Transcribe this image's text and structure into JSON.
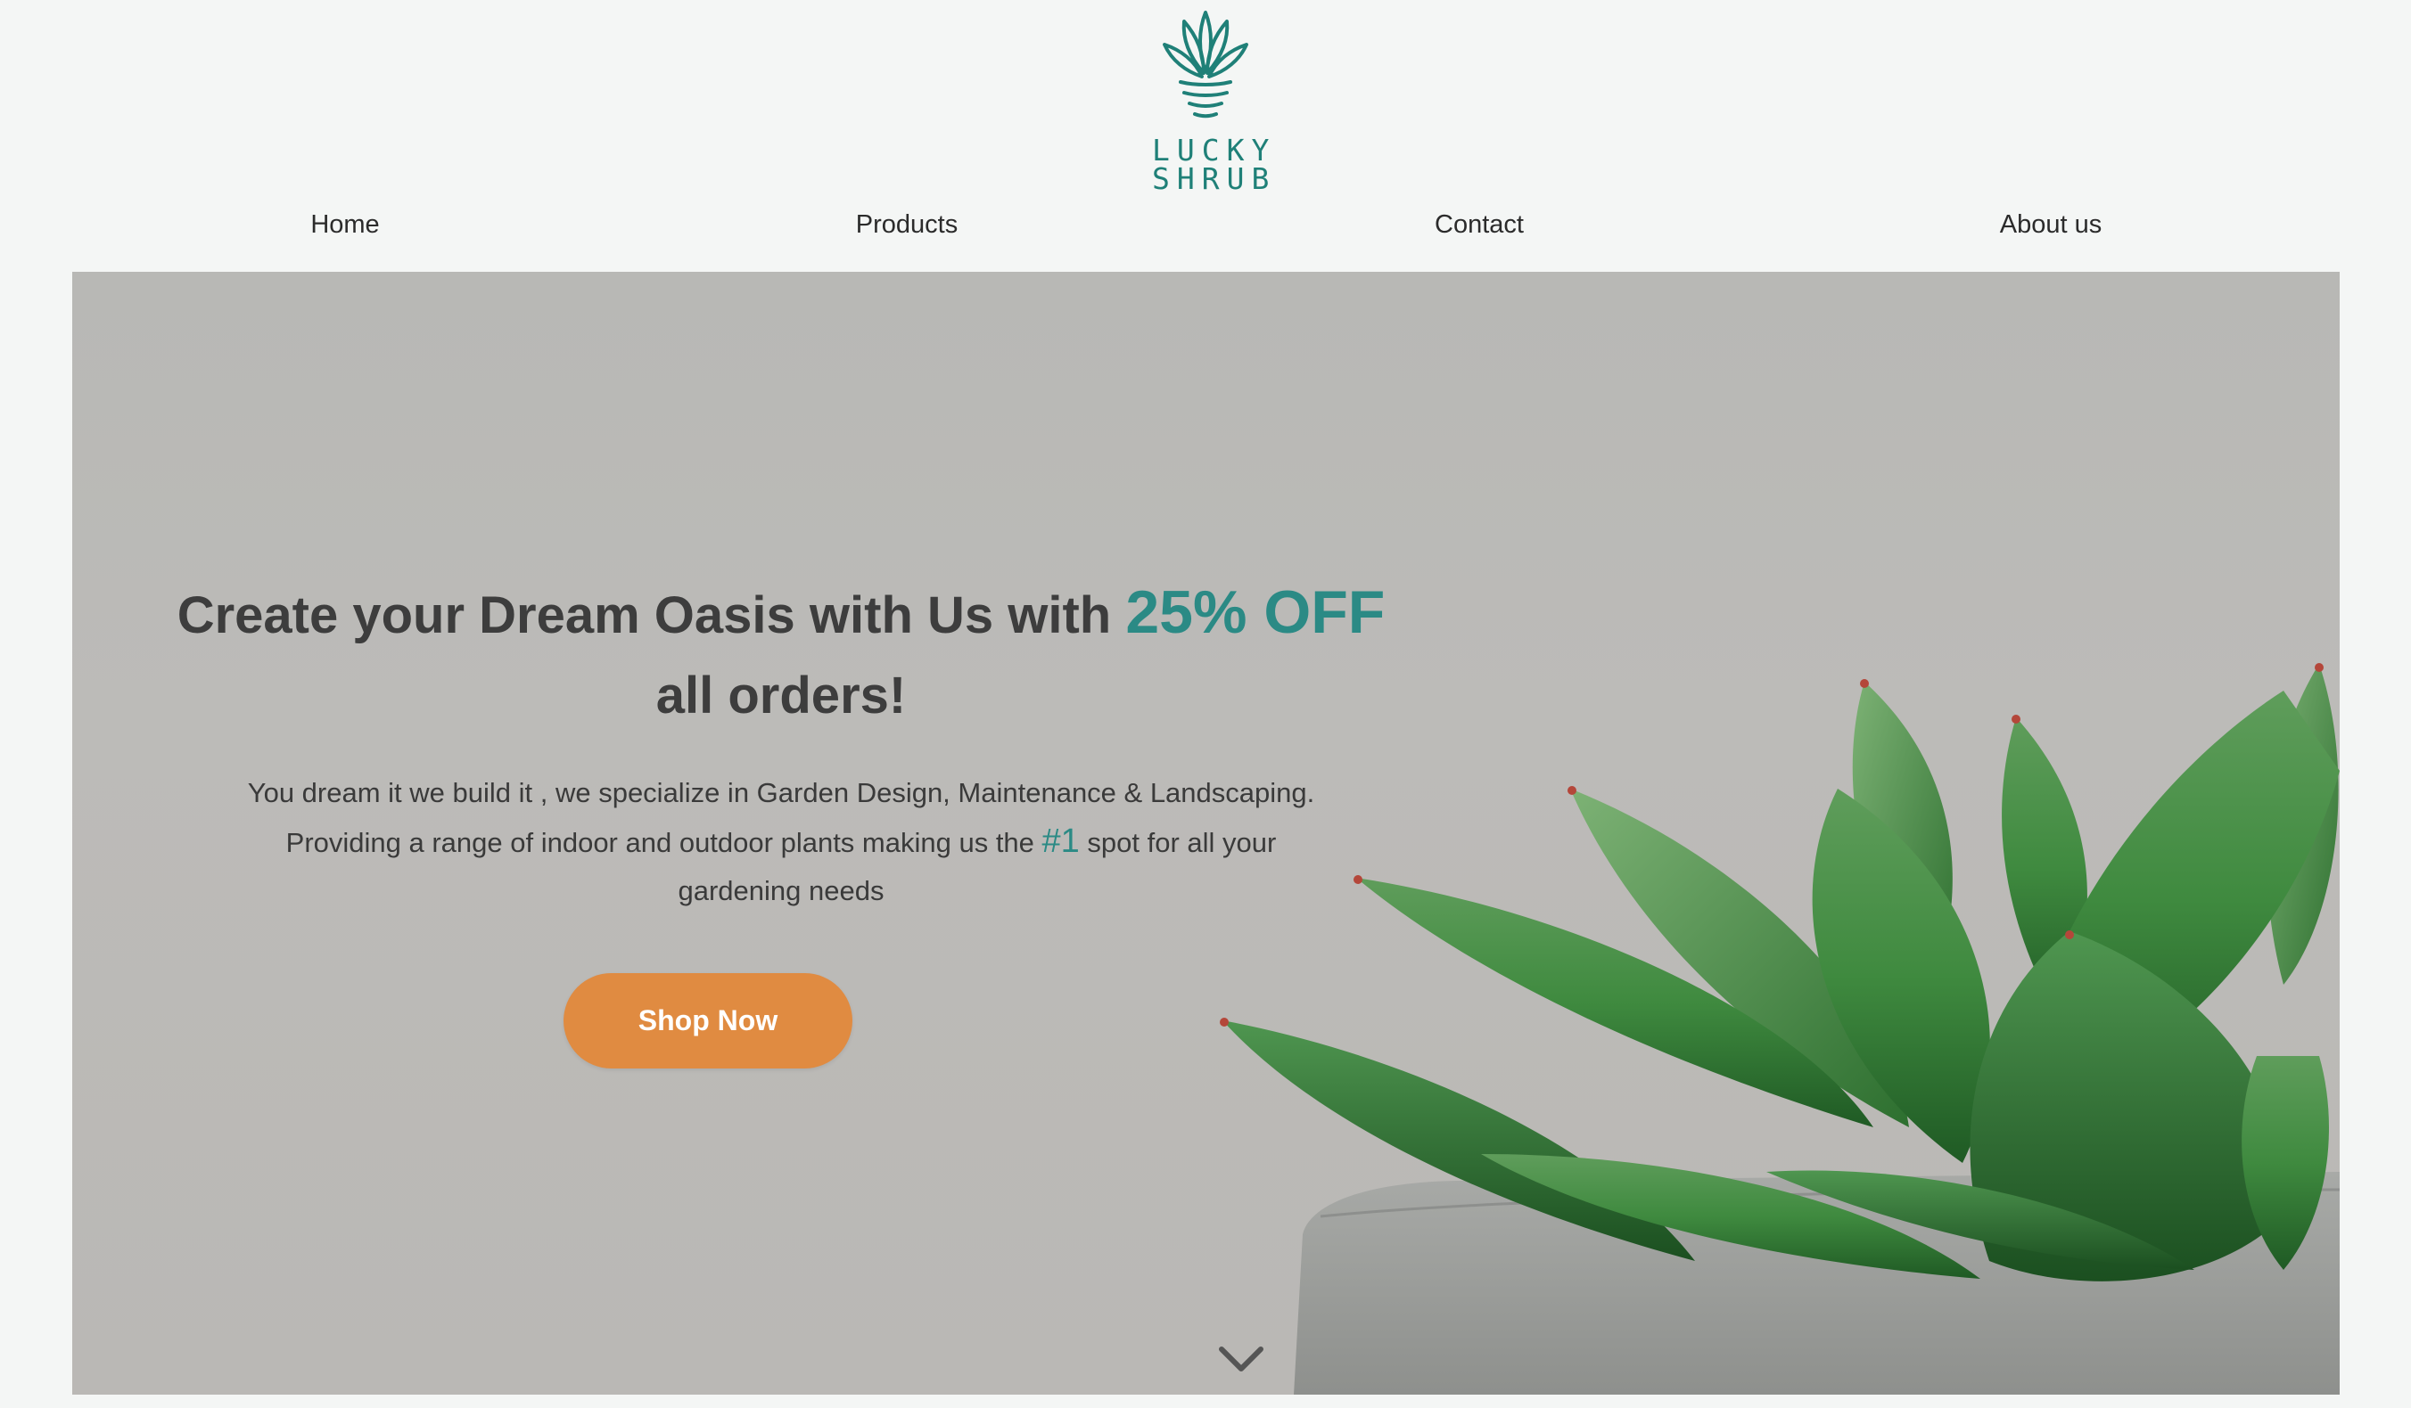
{
  "brand": {
    "logo_line1": "LUCKY",
    "logo_line2": "SHRUB",
    "color": "#1f8078"
  },
  "nav": {
    "items": [
      {
        "label": "Home"
      },
      {
        "label": "Products"
      },
      {
        "label": "Contact"
      },
      {
        "label": "About us"
      }
    ]
  },
  "hero": {
    "title_part1": "Create your Dream Oasis with Us with ",
    "title_accent": "25% OFF",
    "title_part2": "all orders!",
    "description_line1": "You dream it we build it , we specialize in Garden Design, Maintenance & Landscaping.",
    "description_part2": "Providing a range of indoor and outdoor plants making us the ",
    "description_accent": "#1",
    "description_part3": " spot for all your",
    "description_line3": "gardening needs",
    "cta_label": "Shop Now",
    "accent_color": "#2b8a85",
    "cta_color": "#e08b41",
    "scroll_icon": "chevron-down-icon"
  }
}
